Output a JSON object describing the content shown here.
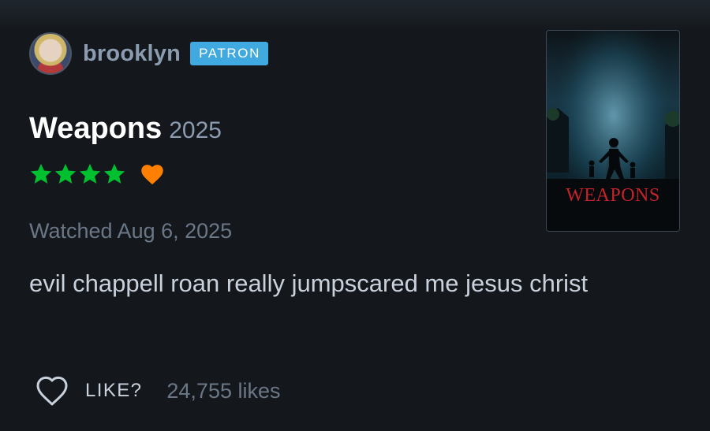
{
  "user": {
    "name": "brooklyn",
    "badge": "PATRON"
  },
  "film": {
    "title": "Weapons",
    "year": "2025",
    "poster_title": "WEAPONS"
  },
  "rating": {
    "stars": 4,
    "max_stars": 5,
    "liked": true,
    "star_color": "#00c030",
    "heart_color": "#ff8000"
  },
  "watched": "Watched Aug 6, 2025",
  "review": "evil chappell roan really jumpscared me jesus christ",
  "like": {
    "label": "LIKE?",
    "count": "24,755 likes"
  },
  "icons": {
    "star": "star-icon",
    "liked": "heart-filled-icon",
    "like": "heart-outline-icon"
  }
}
